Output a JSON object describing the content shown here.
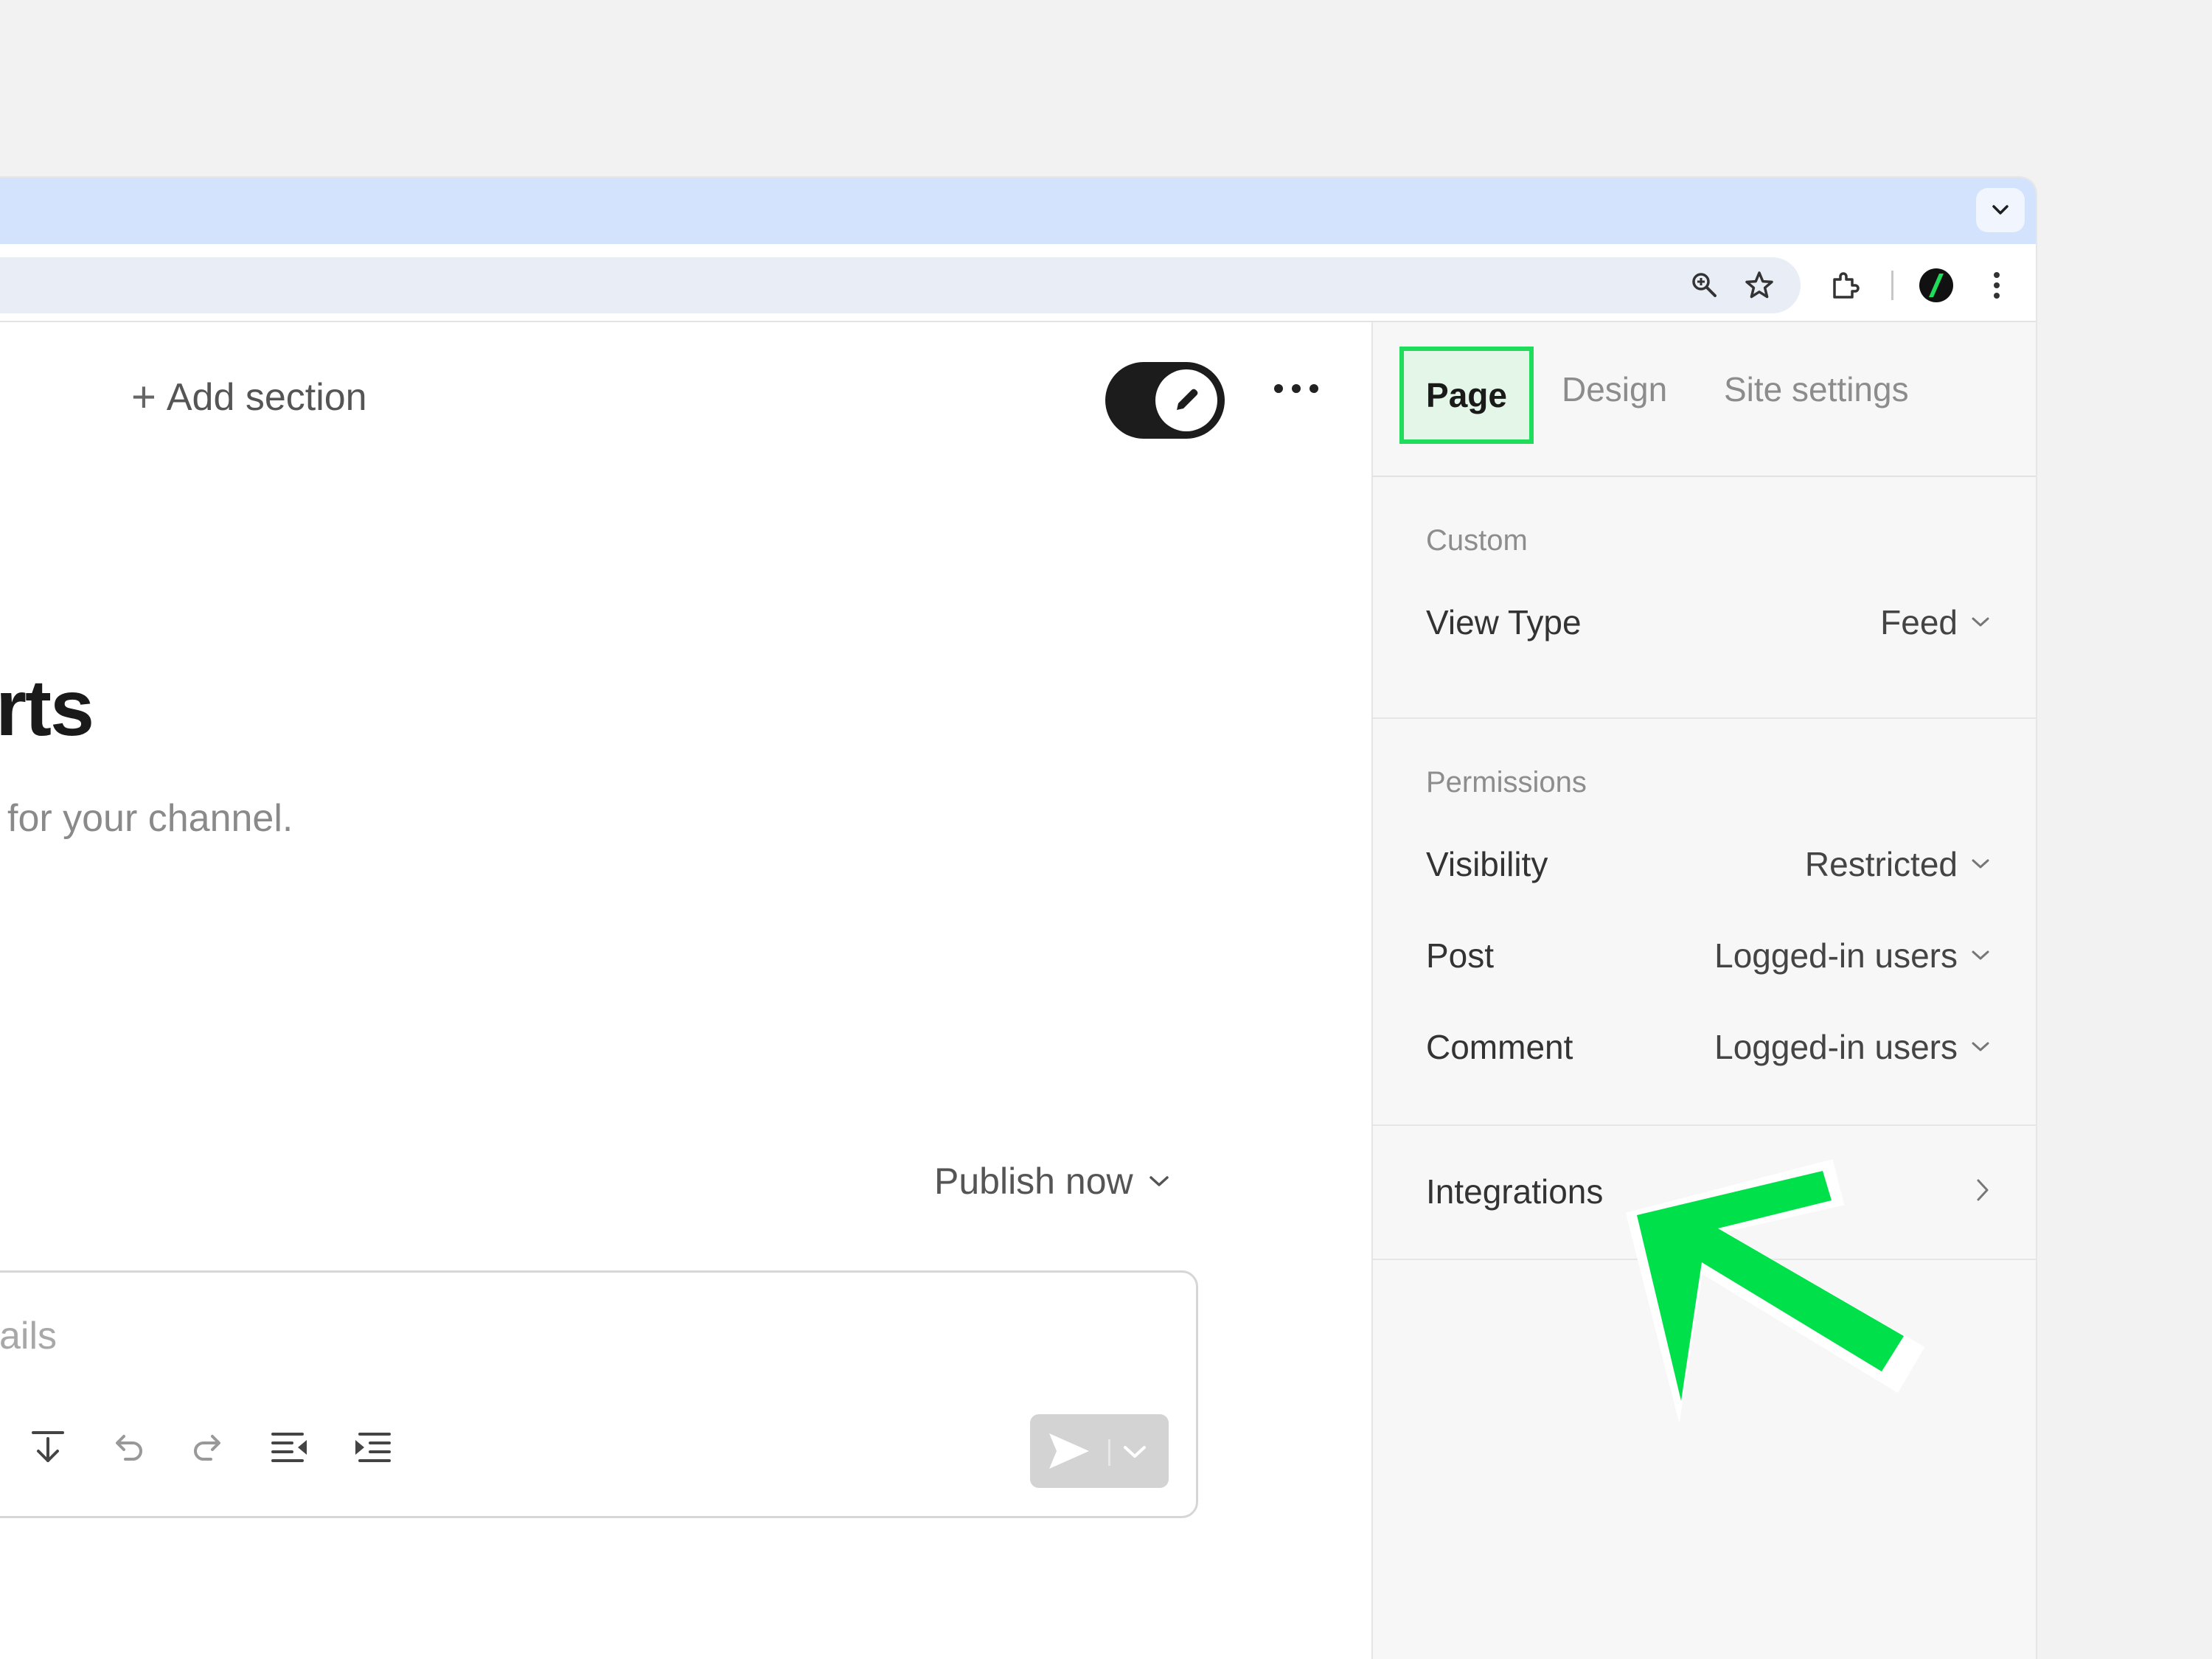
{
  "browser": {
    "icons": [
      "chevron-down-icon",
      "zoom-icon",
      "star-icon",
      "extensions-icon",
      "profile-avatar",
      "kebab-menu-icon"
    ]
  },
  "editor_header": {
    "add_section": "Add section",
    "add_icon": "+"
  },
  "page": {
    "title": "rts",
    "subtitle": "for your channel.",
    "publish_label": "Publish now",
    "composer_placeholder": "ails"
  },
  "panel": {
    "tabs": [
      {
        "label": "Page",
        "active": true
      },
      {
        "label": "Design",
        "active": false
      },
      {
        "label": "Site settings",
        "active": false
      }
    ],
    "custom": {
      "title": "Custom",
      "view_type_label": "View Type",
      "view_type_value": "Feed"
    },
    "permissions": {
      "title": "Permissions",
      "visibility_label": "Visibility",
      "visibility_value": "Restricted",
      "post_label": "Post",
      "post_value": "Logged-in users",
      "comment_label": "Comment",
      "comment_value": "Logged-in users"
    },
    "integrations": {
      "label": "Integrations"
    }
  },
  "colors": {
    "highlight_green": "#00e04a",
    "tab_strip": "#d3e3fd"
  }
}
